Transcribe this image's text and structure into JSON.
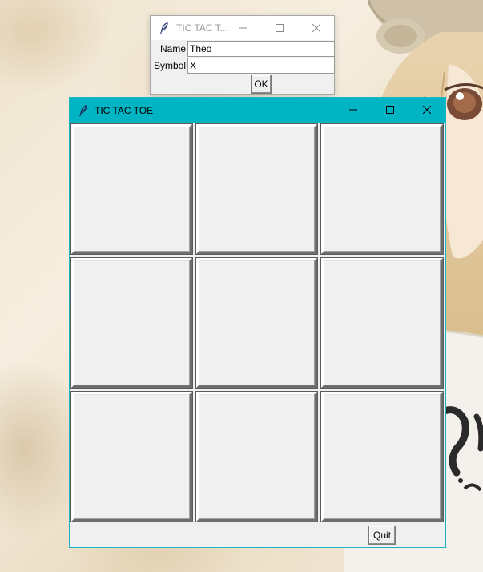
{
  "colors": {
    "main_titlebar": "#00b4c4",
    "window_bg": "#f0f0f0",
    "dialog_title_text": "#999999"
  },
  "dialog": {
    "title": "TIC TAC T...",
    "app_icon": "feather-icon",
    "fields": [
      {
        "label": "Name",
        "value": "Theo"
      },
      {
        "label": "Symbol",
        "value": "X"
      }
    ],
    "ok_label": "OK"
  },
  "game": {
    "title": "TIC TAC TOE",
    "app_icon": "feather-icon",
    "cells": [
      "",
      "",
      "",
      "",
      "",
      "",
      "",
      "",
      ""
    ],
    "quit_label": "Quit"
  }
}
